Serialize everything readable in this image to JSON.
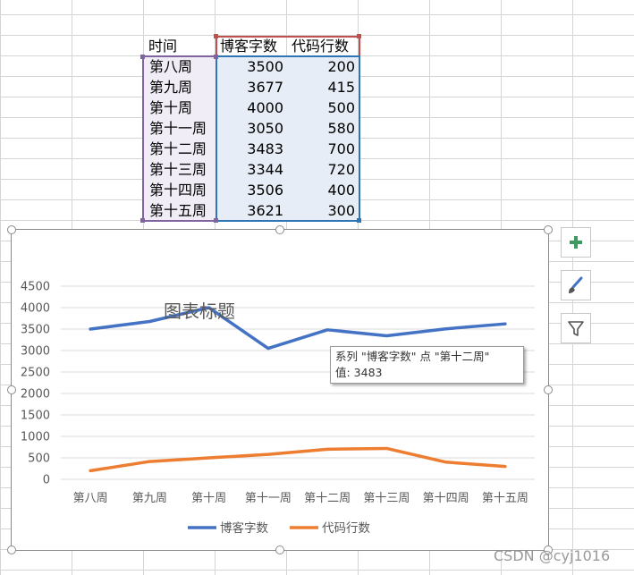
{
  "table": {
    "header": {
      "label": "时间",
      "col1": "博客字数",
      "col2": "代码行数"
    },
    "rows": [
      {
        "label": "第八周",
        "col1": "3500",
        "col2": "200"
      },
      {
        "label": "第九周",
        "col1": "3677",
        "col2": "415"
      },
      {
        "label": "第十周",
        "col1": "4000",
        "col2": "500"
      },
      {
        "label": "第十一周",
        "col1": "3050",
        "col2": "580"
      },
      {
        "label": "第十二周",
        "col1": "3483",
        "col2": "700"
      },
      {
        "label": "第十三周",
        "col1": "3344",
        "col2": "720"
      },
      {
        "label": "第十四周",
        "col1": "3506",
        "col2": "400"
      },
      {
        "label": "第十五周",
        "col1": "3621",
        "col2": "300"
      }
    ]
  },
  "chart": {
    "title": "图表标题",
    "tooltip": {
      "line1": "系列 \"博客字数\" 点 \"第十二周\"",
      "line2": "值: 3483"
    }
  },
  "chart_tools": {
    "add_elements": "add-icon",
    "styles": "brush-icon",
    "filters": "filter-icon"
  },
  "watermark": "CSDN @cyj1016",
  "colors": {
    "series1": "#4472c4",
    "series2": "#ed7d31",
    "label_col_fill": "#f0edf6",
    "value_col_fill": "#e7edf6"
  },
  "chart_data": {
    "type": "line",
    "title": "图表标题",
    "categories": [
      "第八周",
      "第九周",
      "第十周",
      "第十一周",
      "第十二周",
      "第十三周",
      "第十四周",
      "第十五周"
    ],
    "series": [
      {
        "name": "博客字数",
        "color": "#4472c4",
        "values": [
          3500,
          3677,
          4000,
          3050,
          3483,
          3344,
          3506,
          3621
        ]
      },
      {
        "name": "代码行数",
        "color": "#ed7d31",
        "values": [
          200,
          415,
          500,
          580,
          700,
          720,
          400,
          300
        ]
      }
    ],
    "ylim": [
      0,
      4500
    ],
    "yticks": [
      0,
      500,
      1000,
      1500,
      2000,
      2500,
      3000,
      3500,
      4000,
      4500
    ],
    "grid": true,
    "legend": "bottom"
  }
}
